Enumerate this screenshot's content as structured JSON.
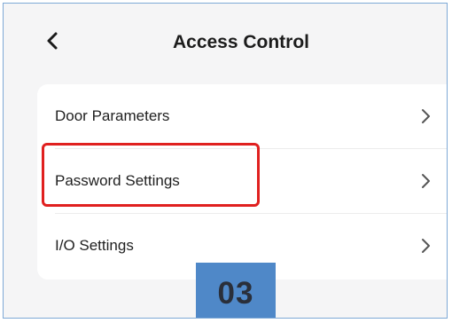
{
  "header": {
    "title": "Access Control",
    "back_icon": "chevron-left-icon"
  },
  "menu": {
    "items": [
      {
        "label": "Door Parameters",
        "icon": "chevron-right-icon"
      },
      {
        "label": "Password Settings",
        "icon": "chevron-right-icon",
        "highlighted": true
      },
      {
        "label": "I/O Settings",
        "icon": "chevron-right-icon"
      }
    ]
  },
  "annotation": {
    "step_label": "03",
    "highlight_color": "#e0201f",
    "badge_color": "#4f88c8"
  }
}
